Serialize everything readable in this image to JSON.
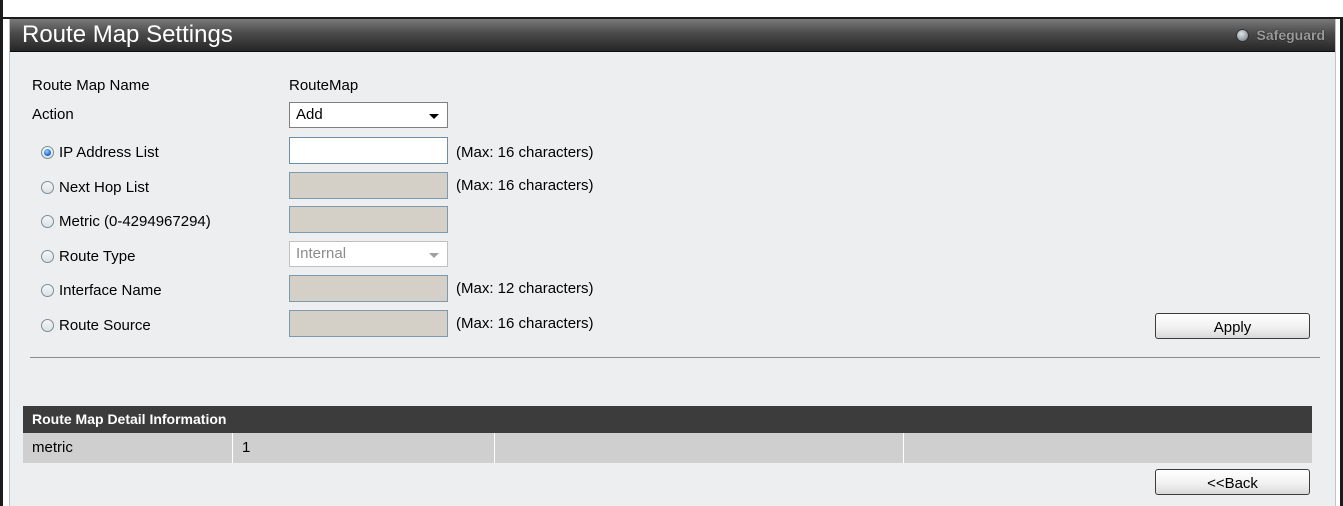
{
  "panel": {
    "title": "Route Map Settings",
    "safeguard_label": "Safeguard"
  },
  "form": {
    "route_map_name_label": "Route Map Name",
    "route_map_name_value": "RouteMap",
    "action_label": "Action",
    "action_value": "Add",
    "options": [
      {
        "label": "IP Address List",
        "selected": true,
        "control": "text",
        "value": "",
        "enabled": true,
        "hint": "(Max: 16 characters)"
      },
      {
        "label": "Next Hop List",
        "selected": false,
        "control": "text",
        "value": "",
        "enabled": false,
        "hint": "(Max: 16 characters)"
      },
      {
        "label": "Metric (0-4294967294)",
        "selected": false,
        "control": "text",
        "value": "",
        "enabled": false,
        "hint": ""
      },
      {
        "label": "Route Type",
        "selected": false,
        "control": "select",
        "value": "Internal",
        "enabled": false,
        "hint": ""
      },
      {
        "label": "Interface Name",
        "selected": false,
        "control": "text",
        "value": "",
        "enabled": false,
        "hint": "(Max: 12 characters)"
      },
      {
        "label": "Route Source",
        "selected": false,
        "control": "text",
        "value": "",
        "enabled": false,
        "hint": "(Max: 16 characters)"
      }
    ],
    "apply_label": "Apply"
  },
  "detail_table": {
    "header": "Route Map Detail Information",
    "rows": [
      [
        "metric",
        "1",
        "",
        ""
      ]
    ]
  },
  "back_label": "<<Back",
  "colors": {
    "title_bar": "#3a3a3a",
    "panel_bg": "#eceeef",
    "table_header": "#3c3c3c",
    "table_row": "#cfcfcf",
    "disabled_input": "#d4d0c8"
  }
}
